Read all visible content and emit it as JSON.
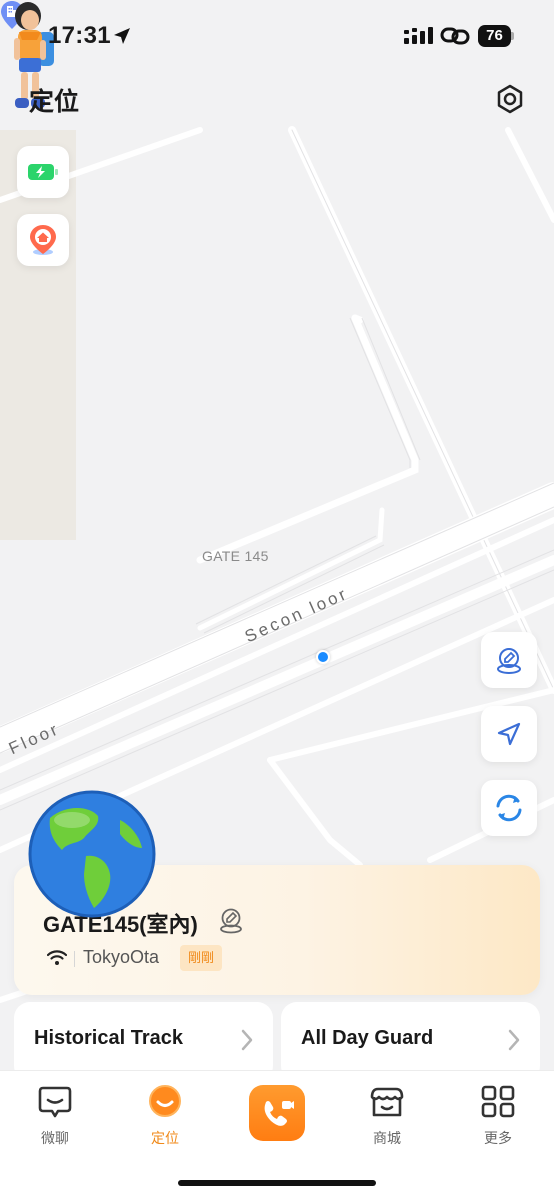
{
  "status_bar": {
    "time": "17:31",
    "battery": "76"
  },
  "header": {
    "title": "定位"
  },
  "map": {
    "poi_label": "GATE 145",
    "road_label_1": "Secon  loor",
    "road_label_2": "Floor"
  },
  "location_card": {
    "place": "GATE145(室內)",
    "city": "TokyoOta",
    "badge": "剛剛"
  },
  "actions": {
    "historical_track": "Historical Track",
    "all_day_guard": "All Day Guard"
  },
  "tabs": [
    {
      "label": "微聊",
      "icon": "chat-icon"
    },
    {
      "label": "定位",
      "icon": "location-icon",
      "active": true
    },
    {
      "label": "",
      "icon": "video-call-icon"
    },
    {
      "label": "商城",
      "icon": "shop-icon"
    },
    {
      "label": "更多",
      "icon": "grid-icon"
    }
  ],
  "colors": {
    "accent": "#F08A1A",
    "dot": "#1A8BFF",
    "battery_green": "#2BD46B"
  }
}
